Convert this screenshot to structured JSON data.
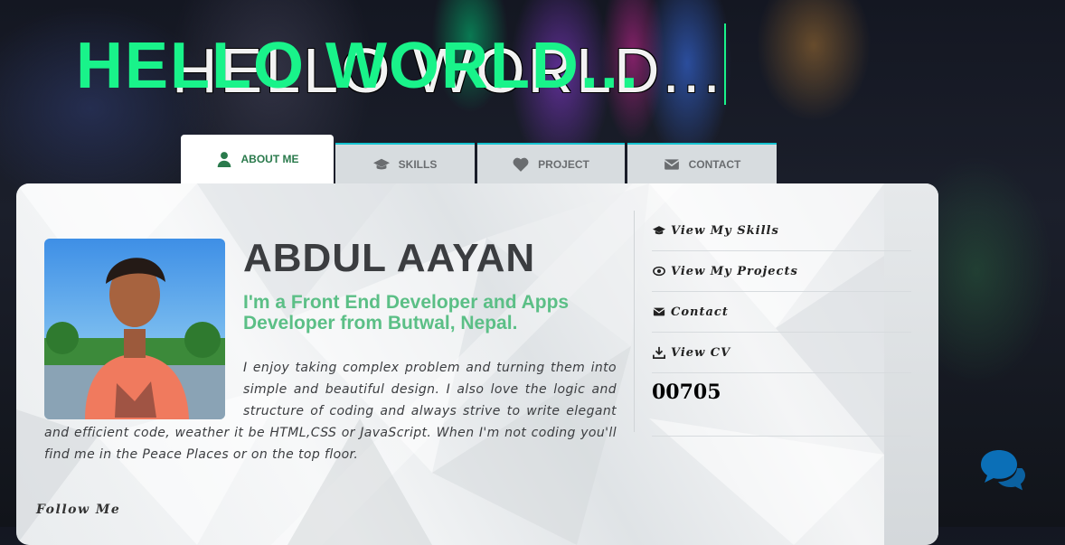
{
  "hero": {
    "title_front": "HELLO WORLD...",
    "title_back": "HELLO WORLD..."
  },
  "tabs": [
    {
      "label": "ABOUT ME",
      "icon": "user-icon",
      "active": true
    },
    {
      "label": "SKILLS",
      "icon": "graduation-cap-icon",
      "active": false
    },
    {
      "label": "PROJECT",
      "icon": "heart-icon",
      "active": false
    },
    {
      "label": "CONTACT",
      "icon": "envelope-icon",
      "active": false
    }
  ],
  "profile": {
    "name": "ABDUL AAYAN",
    "role": "I'm a Front End Developer and Apps Developer from Butwal, Nepal.",
    "bio": "I enjoy taking complex problem and turning them into simple and beautiful design. I also love the logic and structure of coding and always strive to write elegant and efficient code, weather it be HTML,CSS or JavaScript. When I'm not coding you'll find me in the Peace Places or on the top floor.",
    "follow_label": "Follow Me"
  },
  "menu": {
    "items": [
      {
        "label": "View My Skills",
        "icon": "graduation-cap-icon"
      },
      {
        "label": "View My Projects",
        "icon": "eye-icon"
      },
      {
        "label": "Contact",
        "icon": "envelope-icon"
      },
      {
        "label": "View CV",
        "icon": "download-icon"
      }
    ],
    "counter": "00705"
  },
  "colors": {
    "accent_green": "#19f38a",
    "role_green": "#5bbf86",
    "tab_active_text": "#2a7a4c",
    "tab_border": "#16c3d0",
    "chat_blue": "#0b6fb7"
  }
}
